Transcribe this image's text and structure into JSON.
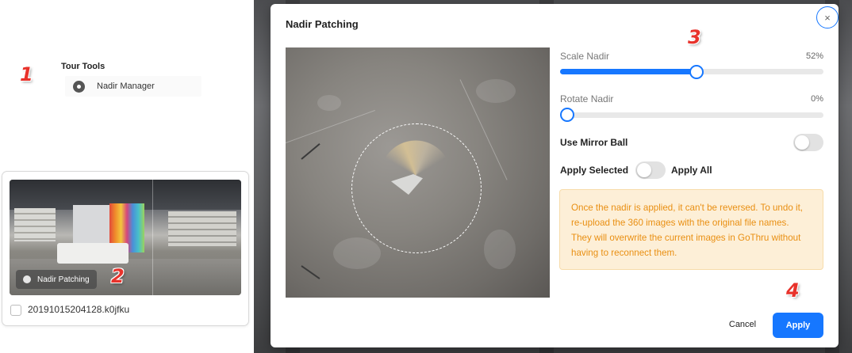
{
  "left_panel": {
    "tools_title": "Tour Tools",
    "tools_item_label": "Nadir Manager",
    "card": {
      "badge_label": "Nadir Patching",
      "file_name": "20191015204128.k0jfku"
    }
  },
  "annotations": {
    "step1": "1",
    "step2": "2",
    "step3": "3",
    "step4": "4"
  },
  "modal": {
    "title": "Nadir Patching",
    "close_label": "×",
    "scale": {
      "label": "Scale Nadir",
      "value_text": "52%",
      "value": 52
    },
    "rotate": {
      "label": "Rotate Nadir",
      "value_text": "0%",
      "value": 0
    },
    "mirror_ball": {
      "label": "Use Mirror Ball",
      "on": false
    },
    "apply_scope": {
      "left_label": "Apply Selected",
      "right_label": "Apply All",
      "apply_all": false
    },
    "warning": "Once the nadir is applied, it can't be reversed. To undo it, re-upload the 360 images with the original file names. They will overwrite the current images in GoThru without having to reconnect them.",
    "cancel_label": "Cancel",
    "apply_label": "Apply"
  },
  "colors": {
    "accent": "#1677ff",
    "warning_bg": "#fdefd7",
    "warning_text": "#e98f12",
    "annotation_red": "#e8322b"
  }
}
